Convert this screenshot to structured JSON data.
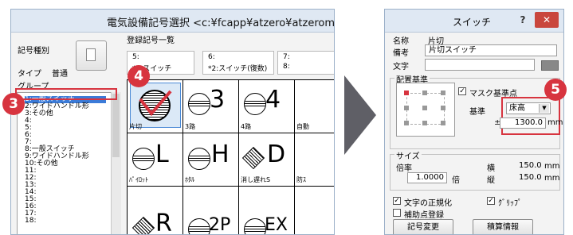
{
  "left_window": {
    "title": "電気設備記号選択 <c:¥fcapp¥atzero¥atzeromaste",
    "kind_label": "記号種別",
    "type_label": "タイプ",
    "type_value": "普通",
    "group_label": "グループ",
    "registered_label": "登録記号一覧",
    "groups": [
      "1:一般スイッチ",
      "2:ワイドハンドル形",
      "3:その他",
      "4:",
      "5:",
      "6:",
      "7:",
      "8:一般スイッチ",
      "9:ワイドハンドル形",
      "10:その他",
      "11:",
      "12:",
      "13:",
      "14:",
      "15:",
      "16:",
      "17:",
      "18:"
    ],
    "selected_group": "1:一般スイッチ",
    "header_cells": [
      {
        "num": "5:",
        "name": "*1:スイッチ"
      },
      {
        "num": "6:",
        "name": "*2:スイッチ(復数)"
      },
      {
        "num": "7:",
        "name": "8:"
      }
    ],
    "symbols": [
      {
        "glyph": "",
        "name": "片切"
      },
      {
        "glyph": "3",
        "name": "3路"
      },
      {
        "glyph": "4",
        "name": "4路"
      },
      {
        "glyph": "",
        "name": "自動"
      },
      {
        "glyph": "L",
        "name": "ﾊﾟｲﾛｯﾄ"
      },
      {
        "glyph": "H",
        "name": "ﾎﾀﾙ"
      },
      {
        "glyph": "D",
        "name": "消し遅れS"
      },
      {
        "glyph": "",
        "name": "防ｽ"
      },
      {
        "glyph": "R",
        "name": ""
      },
      {
        "glyph": "2P",
        "name": ""
      },
      {
        "glyph": "EX",
        "name": ""
      }
    ]
  },
  "badges": {
    "b3": "3",
    "b4": "4",
    "b5": "5"
  },
  "dialog": {
    "title": "スイッチ",
    "help": "?",
    "close": "✕",
    "name_label": "名称",
    "name_value": "片切",
    "note_label": "備考",
    "note_value": "片切スイッチ",
    "text_label": "文字",
    "text_value": "",
    "placement_label": "配置基準",
    "mask_label": "マスク基準点",
    "base_label": "基準",
    "base_value": "床高",
    "pm_label": "±",
    "offset_value": "1300.0",
    "offset_unit": "mm",
    "size_label": "サイズ",
    "scale_label": "倍率",
    "scale_value": "1.0000",
    "scale_unit": "倍",
    "width_label": "横",
    "width_value": "150.0",
    "width_unit": "mm",
    "height_label": "縦",
    "height_value": "150.0",
    "height_unit": "mm",
    "normalize_label": "文字の正規化",
    "grip_label": "ｸﾞﾘｯﾌﾟ",
    "aux_label": "補助点登録",
    "change_button": "記号変更",
    "estimate_button": "積算情報"
  },
  "colors": {
    "badge": "#d7343f",
    "selection": "#3b7bd8",
    "highlight": "#d7343f",
    "arrow": "#5f5f66"
  }
}
